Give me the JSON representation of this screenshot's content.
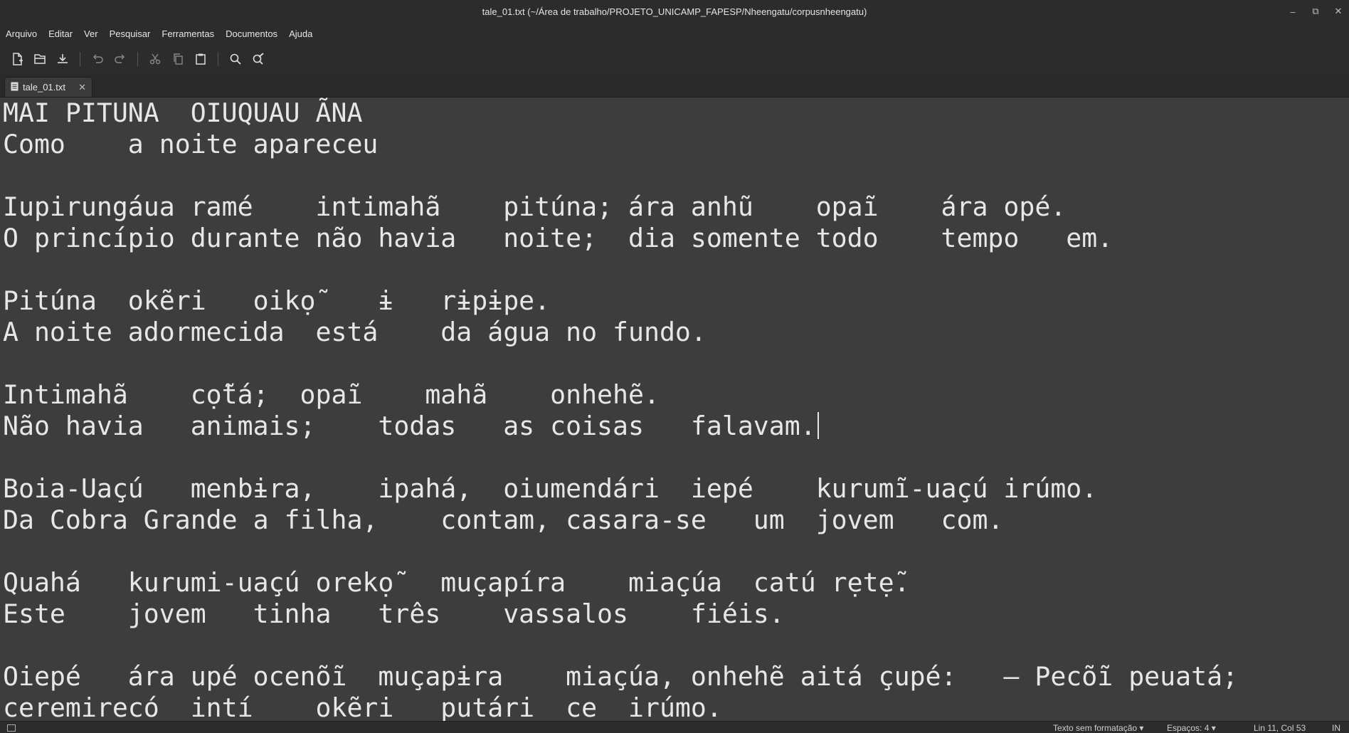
{
  "window": {
    "title": "tale_01.txt (~/Área de trabalho/PROJETO_UNICAMP_FAPESP/Nheengatu/corpusnheengatu)",
    "controls": [
      "–",
      "⧉",
      "✕"
    ]
  },
  "menu": [
    "Arquivo",
    "Editar",
    "Ver",
    "Pesquisar",
    "Ferramentas",
    "Documentos",
    "Ajuda"
  ],
  "toolbar": [
    "new-document-icon",
    "open-icon",
    "save-icon",
    "undo-icon",
    "redo-icon",
    "cut-icon",
    "copy-icon",
    "paste-icon",
    "find-icon",
    "replace-icon"
  ],
  "tab": {
    "label": "tale_01.txt",
    "close": "✕"
  },
  "editor": {
    "lines": [
      "MAI PITUNA  OIUQUAU ÃNA",
      "Como    a noite apareceu",
      "",
      "Iupirungáua ramé    intimahã    pitúna; ára anhũ    opaĩ    ára opé.",
      "O princípio durante não havia   noite;  dia somente todo    tempo   em.",
      "",
      "Pitúna  okẽri   oikọ̃    ɨ   rɨpɨpe.",
      "A noite adormecida  está    da água no fundo.",
      "",
      "Intimahã    cọ̃tá;  opaĩ    mahã    onhehẽ.",
      "Não havia   animais;    todas   as coisas   falavam.",
      "",
      "Boia-Uaçú   menbɨra,    ipahá,  oiumendári  iepé    kurumĩ-uaçú irúmo.",
      "Da Cobra Grande a filha,    contam, casara-se   um  jovem   com.",
      "",
      "Quahá   kurumi-uaçú orekọ̃   muçapíra    miaçúa  catú rẹtẹ̃.",
      "Este    jovem   tinha   três    vassalos    fiéis.",
      "",
      "Oiepé   ára upé ocenõĩ  muçapɨra    miaçúa, onhehẽ aitá çupé:   — Pecõĩ peuatá;",
      "ceremirecó  intí    okẽri   putári  ce  irúmo."
    ]
  },
  "status": {
    "language": "Texto sem formatação ▾",
    "indent": "Espaços: 4 ▾",
    "position": "Lin 11, Col 53",
    "mode": "IN"
  }
}
